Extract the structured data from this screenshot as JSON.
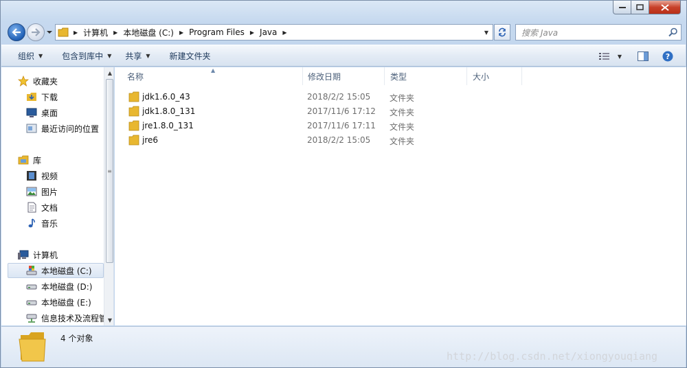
{
  "address": {
    "crumbs": [
      "计算机",
      "本地磁盘 (C:)",
      "Program Files",
      "Java"
    ]
  },
  "search": {
    "placeholder": "搜索 Java"
  },
  "toolbar": {
    "organize": "组织",
    "include_library": "包含到库中",
    "share": "共享",
    "new_folder": "新建文件夹"
  },
  "nav": {
    "favorites": "收藏夹",
    "downloads": "下载",
    "desktop": "桌面",
    "recent": "最近访问的位置",
    "libraries": "库",
    "videos": "视频",
    "pictures": "图片",
    "documents": "文档",
    "music": "音乐",
    "computer": "计算机",
    "drive_c": "本地磁盘 (C:)",
    "drive_d": "本地磁盘 (D:)",
    "drive_e": "本地磁盘 (E:)",
    "network_drive": "信息技术及流程管"
  },
  "columns": {
    "name": "名称",
    "modified": "修改日期",
    "type": "类型",
    "size": "大小"
  },
  "files": [
    {
      "name": "jdk1.6.0_43",
      "modified": "2018/2/2 15:05",
      "type": "文件夹"
    },
    {
      "name": "jdk1.8.0_131",
      "modified": "2017/11/6 17:12",
      "type": "文件夹"
    },
    {
      "name": "jre1.8.0_131",
      "modified": "2017/11/6 17:11",
      "type": "文件夹"
    },
    {
      "name": "jre6",
      "modified": "2018/2/2 15:05",
      "type": "文件夹"
    }
  ],
  "status": {
    "item_count": "4 个对象"
  },
  "watermark": "http://blog.csdn.net/xiongyouqiang",
  "colors": {
    "accent": "#1f5fb5",
    "close": "#c8412a",
    "folder": "#e8b730"
  }
}
